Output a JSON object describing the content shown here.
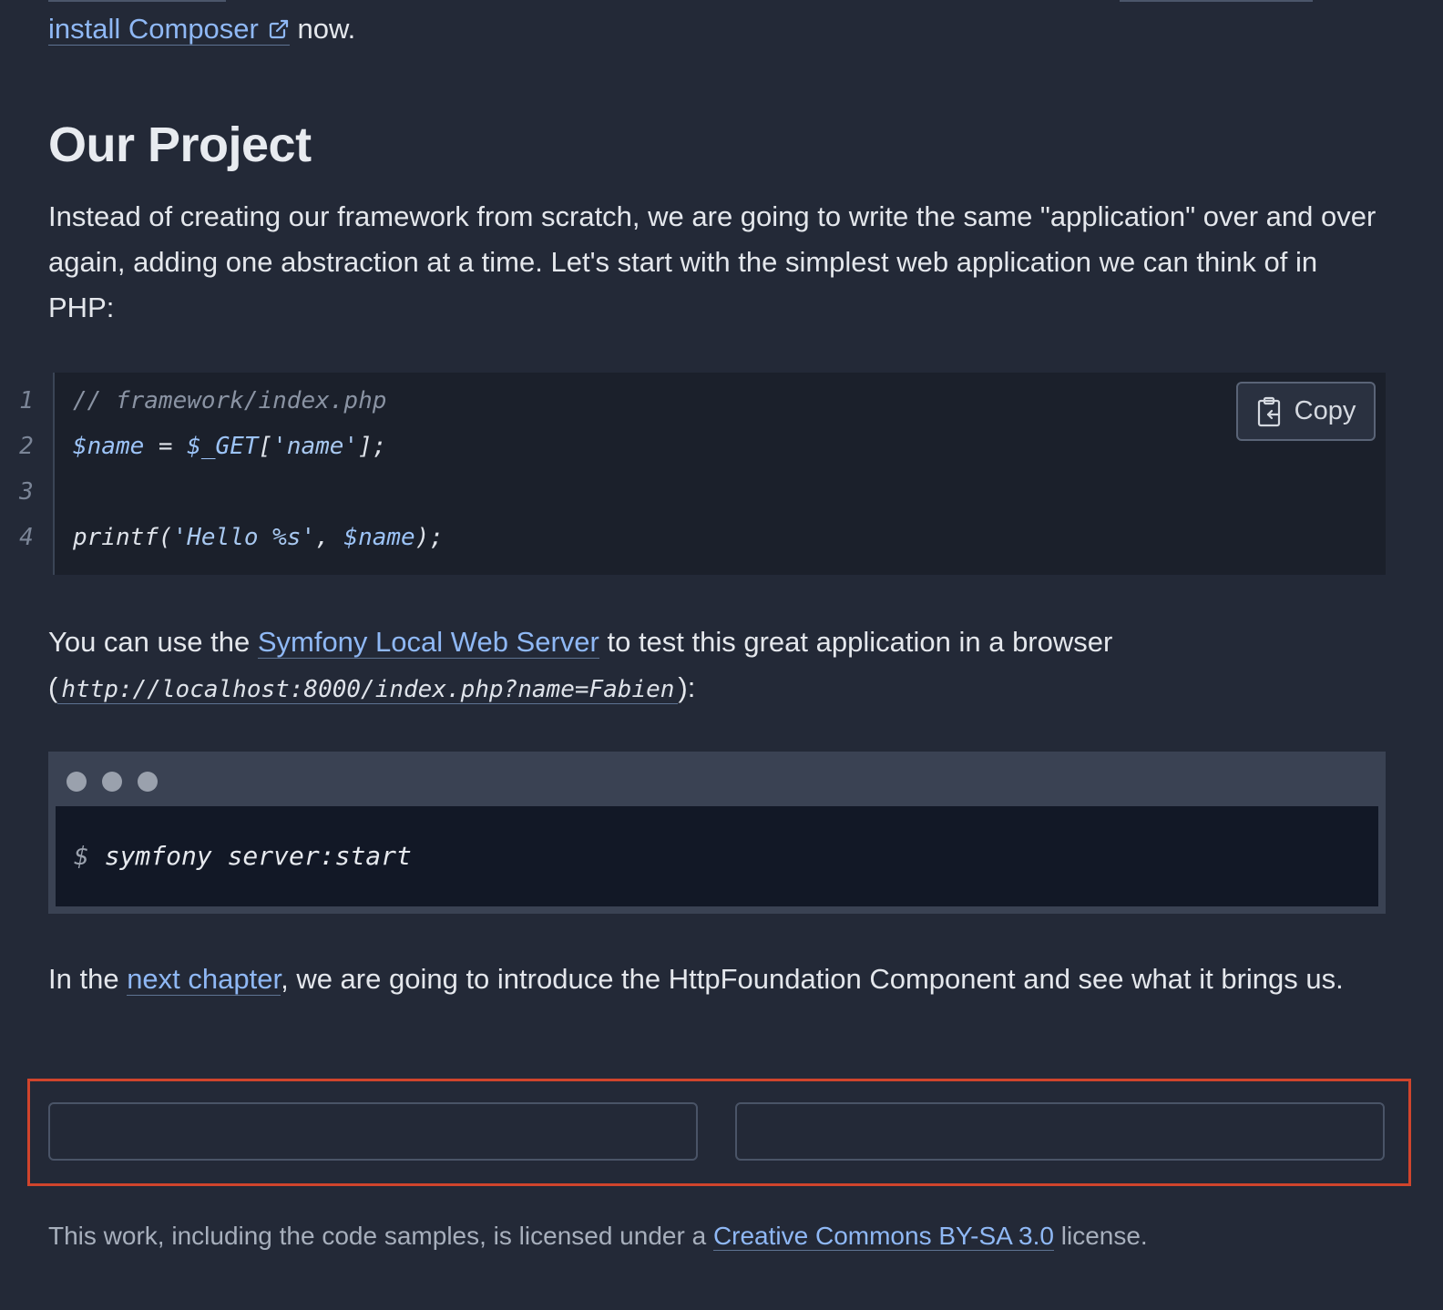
{
  "intro": {
    "link_text": "install Composer",
    "after_text": " now."
  },
  "section": {
    "title": "Our Project",
    "paragraph1": "Instead of creating our framework from scratch, we are going to write the same \"application\" over and over again, adding one abstraction at a time. Let's start with the simplest web application we can think of in PHP:"
  },
  "code": {
    "line_numbers": [
      "1",
      "2",
      "3",
      "4"
    ],
    "line1": "// framework/index.php",
    "line2_var": "$name",
    "line2_mid": " = ",
    "line2_get": "$_GET",
    "line2_open": "[",
    "line2_str": "'name'",
    "line2_end": "];",
    "line4_fn": "printf(",
    "line4_str": "'Hello %s'",
    "line4_comma": ", ",
    "line4_var": "$name",
    "line4_end": ");",
    "copy_label": "Copy"
  },
  "paragraph2": {
    "before": "You can use the ",
    "link": "Symfony Local Web Server",
    "after": " to test this great application in a browser",
    "open_paren": "(",
    "url": "http://localhost:8000/index.php?name=Fabien",
    "close": "):"
  },
  "terminal": {
    "prompt": "$ ",
    "command": "symfony server:start"
  },
  "paragraph3": {
    "before": "In the ",
    "link": "next chapter",
    "after": ", we are going to introduce the HttpFoundation Component and see what it brings us."
  },
  "footer": {
    "before": "This work, including the code samples, is licensed under a ",
    "link": "Creative Commons BY-SA 3.0",
    "after": " license."
  },
  "colors": {
    "background": "#232937",
    "link": "#8fb8f5",
    "highlight": "#d0442c"
  }
}
